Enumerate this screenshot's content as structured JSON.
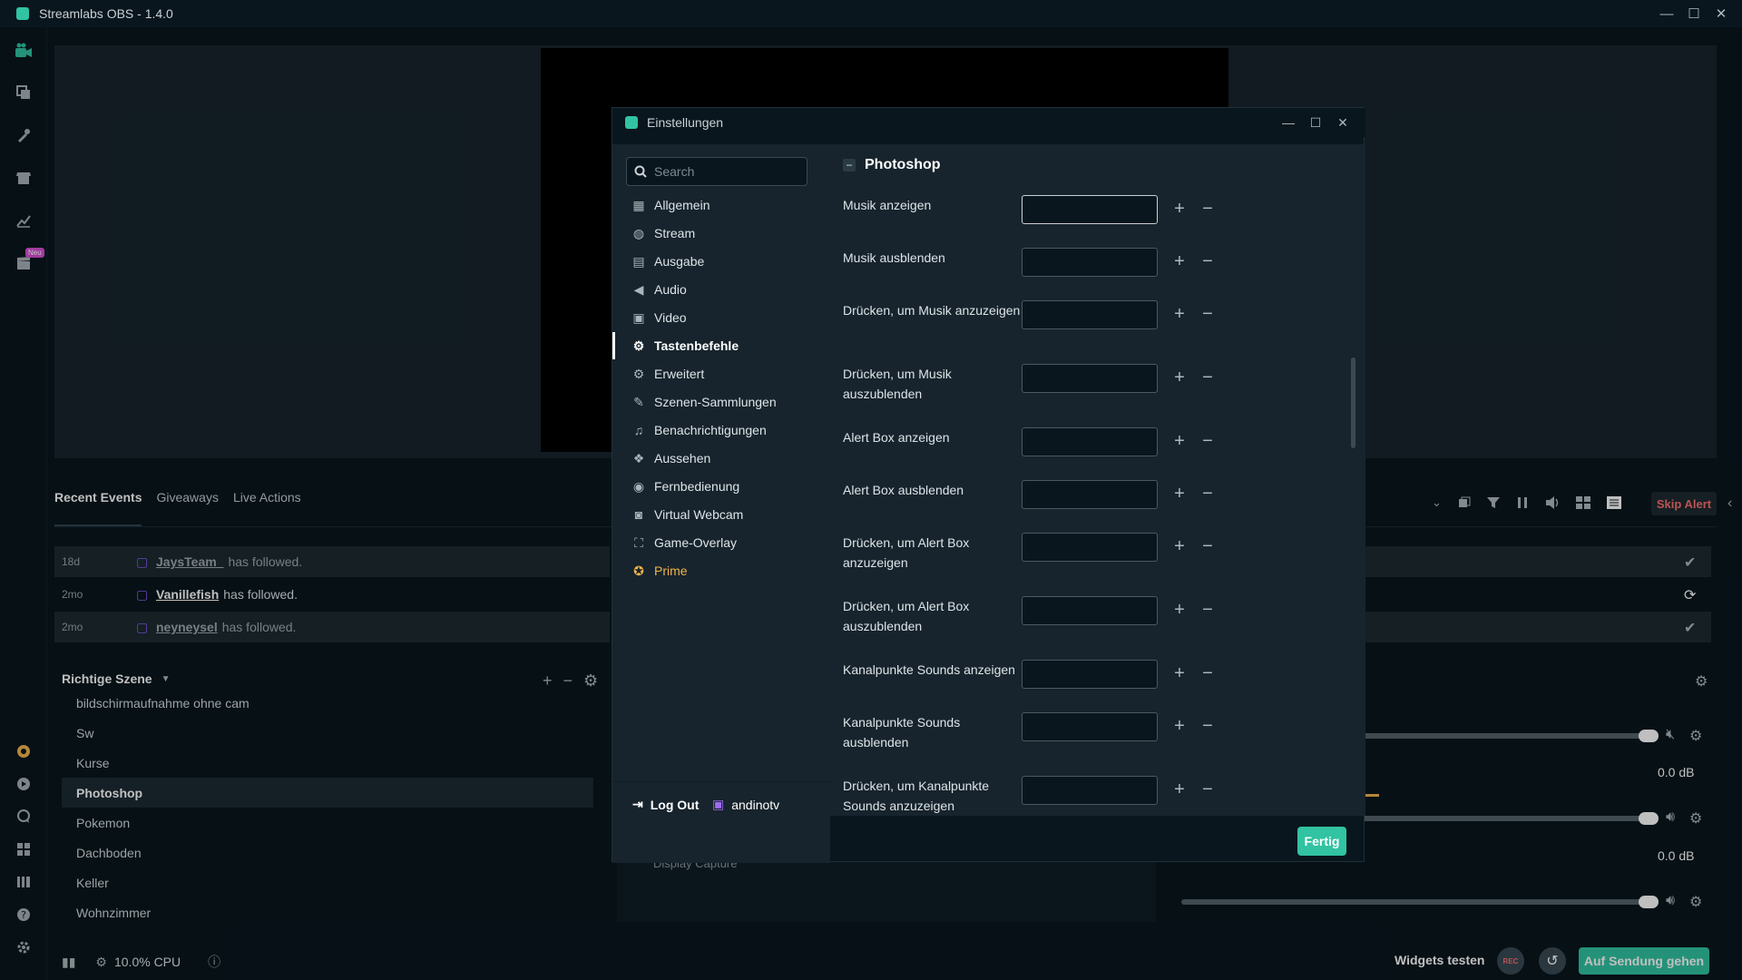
{
  "app": {
    "title": "Streamlabs OBS - 1.4.0",
    "window_controls": [
      "—",
      "☐",
      "✕"
    ]
  },
  "leftnav": {
    "icons": [
      "studio-icon",
      "library-icon",
      "themes-icon",
      "store-icon",
      "analytics-icon",
      "highlighter-icon",
      "prime-icon",
      "cloudbot-icon",
      "chat-icon",
      "layout-icon",
      "studio-mode-icon",
      "help-icon",
      "settings-icon"
    ],
    "neu_badge": "Neu"
  },
  "events": {
    "tabs": [
      "Recent Events",
      "Giveaways",
      "Live Actions"
    ],
    "toolbar_skip_alert": "Skip Alert",
    "rows": [
      {
        "time": "18d",
        "user": "JaysTeam_",
        "action": "has followed."
      },
      {
        "time": "2mo",
        "user": "Vanillefish",
        "action": "has followed."
      },
      {
        "time": "2mo",
        "user": "neyneysel",
        "action": "has followed."
      }
    ]
  },
  "scenes": {
    "title": "Richtige Szene",
    "items": [
      "bildschirmaufnahme ohne cam",
      "Sw",
      "Kurse",
      "Photoshop",
      "Pokemon",
      "Dachboden",
      "Keller",
      "Wohnzimmer"
    ],
    "active_index": 3
  },
  "sources": {
    "partial_item": "Display Capture"
  },
  "mixer": {
    "db_values": [
      "0.0 dB",
      "0.0 dB"
    ]
  },
  "footer": {
    "cpu": "10.0% CPU",
    "widgets_test": "Widgets testen",
    "rec": "REC",
    "go_live": "Auf Sendung gehen"
  },
  "settings": {
    "title": "Einstellungen",
    "search_placeholder": "Search",
    "menu": [
      {
        "label": "Allgemein",
        "icon": "grid-icon"
      },
      {
        "label": "Stream",
        "icon": "globe-icon"
      },
      {
        "label": "Ausgabe",
        "icon": "output-icon"
      },
      {
        "label": "Audio",
        "icon": "speaker-icon"
      },
      {
        "label": "Video",
        "icon": "video-icon"
      },
      {
        "label": "Tastenbefehle",
        "icon": "gear-icon"
      },
      {
        "label": "Erweitert",
        "icon": "cogs-icon"
      },
      {
        "label": "Szenen-Sammlungen",
        "icon": "collections-icon"
      },
      {
        "label": "Benachrichtigungen",
        "icon": "bell-icon"
      },
      {
        "label": "Aussehen",
        "icon": "appearance-icon"
      },
      {
        "label": "Fernbedienung",
        "icon": "remote-icon"
      },
      {
        "label": "Virtual Webcam",
        "icon": "camera-icon"
      },
      {
        "label": "Game-Overlay",
        "icon": "overlay-icon"
      },
      {
        "label": "Prime",
        "icon": "prime-icon"
      }
    ],
    "active_menu_index": 5,
    "logout_label": "Log Out",
    "username": "andinotv",
    "section_title": "Photoshop",
    "hotkeys": [
      "Musik anzeigen",
      "Musik ausblenden",
      "Drücken, um Musik anzuzeigen",
      "Drücken, um Musik auszublenden",
      "Alert Box anzeigen",
      "Alert Box ausblenden",
      "Drücken, um Alert Box anzuzeigen",
      "Drücken, um Alert Box auszublenden",
      "Kanalpunkte Sounds anzeigen",
      "Kanalpunkte Sounds ausblenden",
      "Drücken, um Kanalpunkte Sounds anzuzeigen"
    ],
    "done_label": "Fertig",
    "colors": {
      "accent": "#31c3a2",
      "prime": "#f0b44c",
      "panel": "#17242d",
      "bg": "#09161d",
      "skip_alert": "#f87171"
    }
  }
}
